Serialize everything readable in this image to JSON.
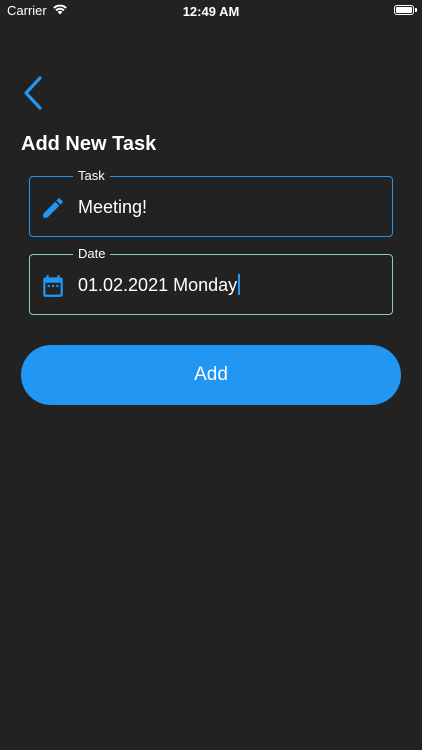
{
  "status_bar": {
    "carrier": "Carrier",
    "time": "12:49 AM",
    "battery_level": 1.0
  },
  "header": {
    "back_icon": "chevron-left-icon",
    "title": "Add New Task"
  },
  "form": {
    "task": {
      "label": "Task",
      "value": "Meeting!",
      "icon": "pencil-icon",
      "border_color": "#2196f3"
    },
    "date": {
      "label": "Date",
      "value": "01.02.2021 Monday",
      "icon": "calendar-icon",
      "border_color": "#8fd19e",
      "focused": true
    }
  },
  "actions": {
    "add_label": "Add"
  },
  "colors": {
    "background": "#222222",
    "accent": "#2196f3"
  }
}
